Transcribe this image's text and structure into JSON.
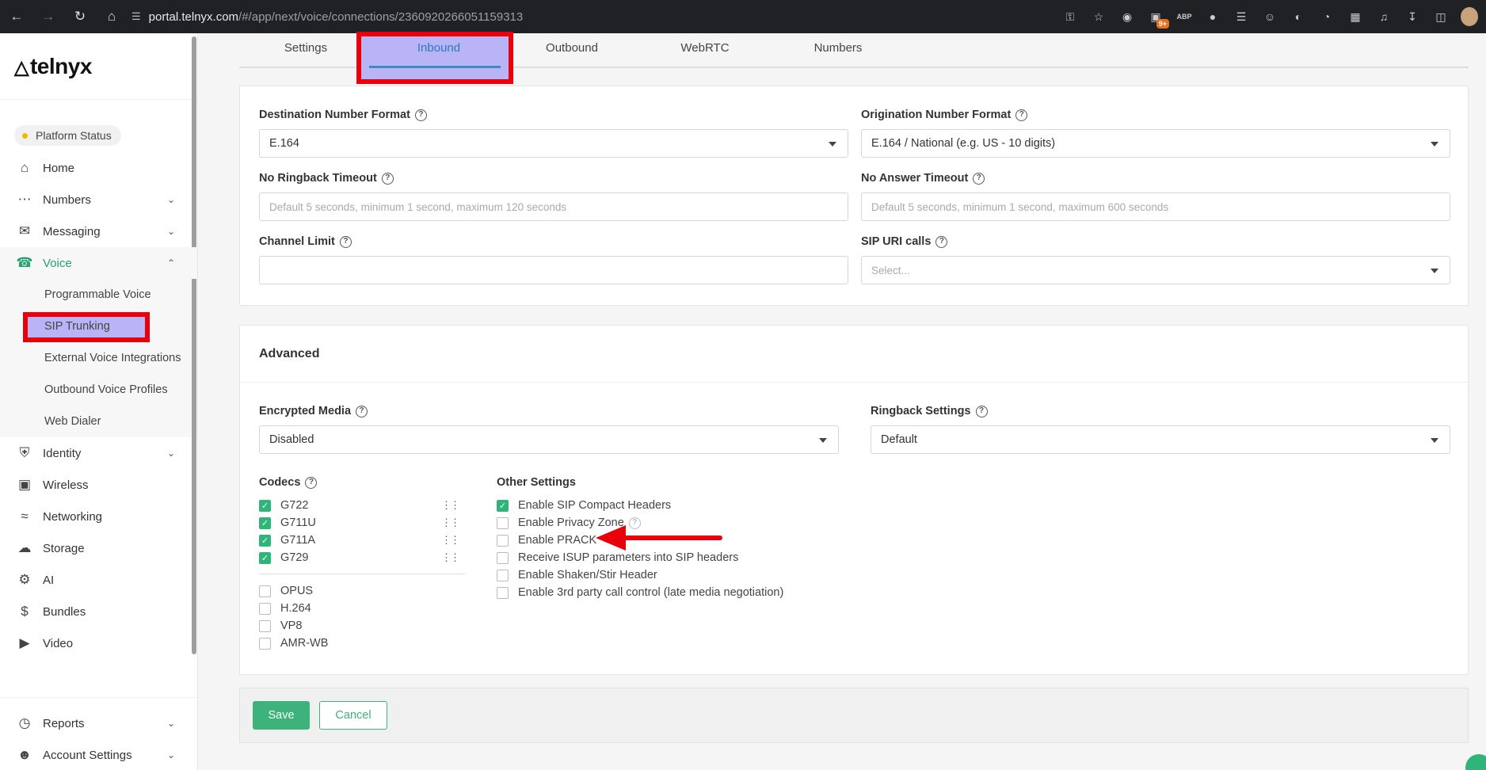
{
  "browser": {
    "url_host": "portal.telnyx.com",
    "url_path": "/#/app/next/voice/connections/2360920266051159313",
    "ext_badge": "9+",
    "abp": "ABP"
  },
  "sidebar": {
    "logo": "telnyx",
    "platform_status": "Platform Status",
    "items": [
      {
        "label": "Home",
        "icon": "home-icon"
      },
      {
        "label": "Numbers",
        "icon": "numbers-icon"
      },
      {
        "label": "Messaging",
        "icon": "messaging-icon"
      },
      {
        "label": "Voice",
        "icon": "phone-icon"
      }
    ],
    "voice_sub": [
      "Programmable Voice",
      "SIP Trunking",
      "External Voice Integrations",
      "Outbound Voice Profiles",
      "Web Dialer"
    ],
    "more_items": [
      {
        "label": "Identity",
        "icon": "shield-icon"
      },
      {
        "label": "Wireless",
        "icon": "sim-icon"
      },
      {
        "label": "Networking",
        "icon": "wifi-icon"
      },
      {
        "label": "Storage",
        "icon": "cloud-icon"
      },
      {
        "label": "AI",
        "icon": "ai-chip-icon"
      },
      {
        "label": "Bundles",
        "icon": "dollar-icon"
      },
      {
        "label": "Video",
        "icon": "video-icon"
      }
    ],
    "bottom_items": [
      {
        "label": "Reports",
        "icon": "reports-icon"
      },
      {
        "label": "Account Settings",
        "icon": "account-icon"
      }
    ]
  },
  "tabs": [
    "Settings",
    "Inbound",
    "Outbound",
    "WebRTC",
    "Numbers"
  ],
  "general": {
    "dest_format_label": "Destination Number Format",
    "dest_format_value": "E.164",
    "orig_format_label": "Origination Number Format",
    "orig_format_value": "E.164 / National (e.g. US - 10 digits)",
    "no_ringback_label": "No Ringback Timeout",
    "no_ringback_placeholder": "Default 5 seconds, minimum 1 second, maximum 120 seconds",
    "no_answer_label": "No Answer Timeout",
    "no_answer_placeholder": "Default 5 seconds, minimum 1 second, maximum 600 seconds",
    "channel_limit_label": "Channel Limit",
    "channel_limit_value": "",
    "sip_uri_label": "SIP URI calls",
    "sip_uri_placeholder": "Select..."
  },
  "advanced": {
    "title": "Advanced",
    "encrypted_label": "Encrypted Media",
    "encrypted_value": "Disabled",
    "ringback_label": "Ringback Settings",
    "ringback_value": "Default",
    "codecs_title": "Codecs",
    "codecs_enabled": [
      "G722",
      "G711U",
      "G711A",
      "G729"
    ],
    "codecs_disabled": [
      "OPUS",
      "H.264",
      "VP8",
      "AMR-WB"
    ],
    "other_title": "Other Settings",
    "other": [
      {
        "label": "Enable SIP Compact Headers",
        "checked": true
      },
      {
        "label": "Enable Privacy Zone",
        "checked": false
      },
      {
        "label": "Enable PRACK",
        "checked": false
      },
      {
        "label": "Receive ISUP parameters into SIP headers",
        "checked": false
      },
      {
        "label": "Enable Shaken/Stir Header",
        "checked": false
      },
      {
        "label": "Enable 3rd party call control (late media negotiation)",
        "checked": false
      }
    ]
  },
  "footer": {
    "save": "Save",
    "cancel": "Cancel"
  },
  "colors": {
    "accent": "#21a46b",
    "annotation_red": "#e8000b",
    "highlight": "#b9b4f5"
  }
}
